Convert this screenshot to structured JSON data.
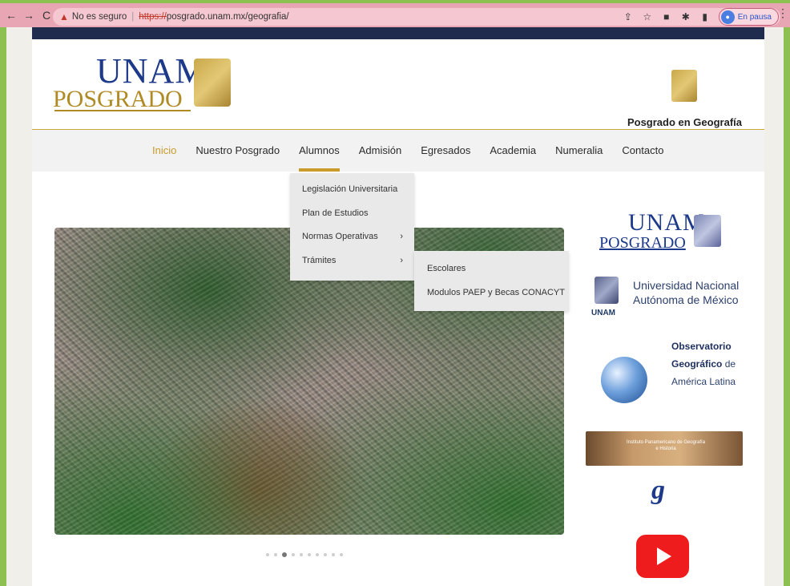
{
  "browser": {
    "security_label": "No es seguro",
    "url_proto": "https://",
    "url_host": "posgrado.unam.mx/geografia/",
    "profile_status": "En pausa"
  },
  "header": {
    "logo_top": "UNAM",
    "logo_bottom": "POSGRADO",
    "title": "Posgrado en Geografía"
  },
  "nav": {
    "items": [
      "Inicio",
      "Nuestro Posgrado",
      "Alumnos",
      "Admisión",
      "Egresados",
      "Academia",
      "Numeralia",
      "Contacto"
    ]
  },
  "menus": {
    "alumnos": [
      {
        "label": "Legislación Universitaria"
      },
      {
        "label": "Plan de Estudios"
      },
      {
        "label": "Normas Operativas"
      },
      {
        "label": "Trámites"
      }
    ],
    "tramites": [
      {
        "label": "Escolares"
      },
      {
        "label": "Modulos PAEP y Becas CONACYT"
      }
    ]
  },
  "sidebar": {
    "posgrado_top": "UNAM",
    "posgrado_bottom": "POSGRADO",
    "unam_abbr": "UNAM",
    "unam_name_1": "Universidad Nacional",
    "unam_name_2": "Autónoma de México",
    "obs_1": "Observatorio",
    "obs_2": "Geográfico",
    "obs_2b": " de",
    "obs_3": "América Latina",
    "ipgh_text": "Instituto Panamericano de Geografía e Historia",
    "g_letter": "g"
  },
  "slider": {
    "dot_count": 10,
    "active_index": 2
  }
}
